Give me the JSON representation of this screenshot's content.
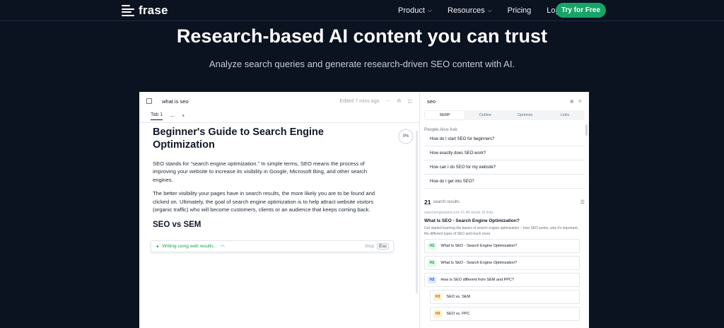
{
  "nav": {
    "logo": "frase",
    "links": [
      {
        "label": "Product",
        "chevron": true
      },
      {
        "label": "Resources",
        "chevron": true
      },
      {
        "label": "Pricing",
        "chevron": false
      },
      {
        "label": "Login",
        "chevron": false
      }
    ],
    "cta": "Try for Free"
  },
  "hero": {
    "title": "Research-based AI content you can trust",
    "subtitle": "Analyze search queries and generate research-driven SEO content with AI."
  },
  "editor": {
    "doc_title": "what is seo",
    "edited": "Edited 7 mins ago",
    "tab": "Tab 1",
    "progress": "0%",
    "heading": "Beginner's Guide to Search Engine Optimization",
    "paragraphs": [
      "SEO stands for “search engine optimization.” In simple terms, SEO means the process of improving your website to increase its visibility in Google, Microsoft Bing, and other search engines.",
      "The better visibility your pages have in search results, the more likely you are to be found and clicked on. Ultimately, the goal of search engine optimization is to help attract website visitors (organic traffic) who will become customers, clients or an audience that keeps coming back."
    ],
    "subheading": "SEO vs SEM",
    "writing_status": "Writing using web results...",
    "stop": "Stop",
    "esc": "Esc"
  },
  "panel": {
    "query": "seo",
    "tabs": [
      "SERP",
      "Outline",
      "Optimize",
      "Links"
    ],
    "active_tab": "SERP",
    "paa_label": "People Also Ask",
    "paa": [
      "How do I start SEO for beginners?",
      "How exactly does SEO work?",
      "How can I do SEO for my website?",
      "How do I get into SEO?"
    ],
    "results_count": "21",
    "results_label": "search results",
    "result": {
      "meta": "searchengineland.com  #1  4K words  36 links",
      "title": "What Is SEO - Search Engine Optimization?",
      "desc": "Get started learning the basics of search engine optimization – how SEO works, why it's important, the different types of SEO and much more."
    },
    "headings": [
      {
        "level": "H1",
        "text": "What Is SEO - Search Engine Optimization?"
      },
      {
        "level": "H1",
        "text": "What Is SEO - Search Engine Optimization?"
      },
      {
        "level": "H2",
        "text": "How is SEO different from SEM and PPC?"
      },
      {
        "level": "H3",
        "text": "SEO vs. SEM"
      },
      {
        "level": "H3",
        "text": "SEO vs. PPC"
      }
    ]
  }
}
